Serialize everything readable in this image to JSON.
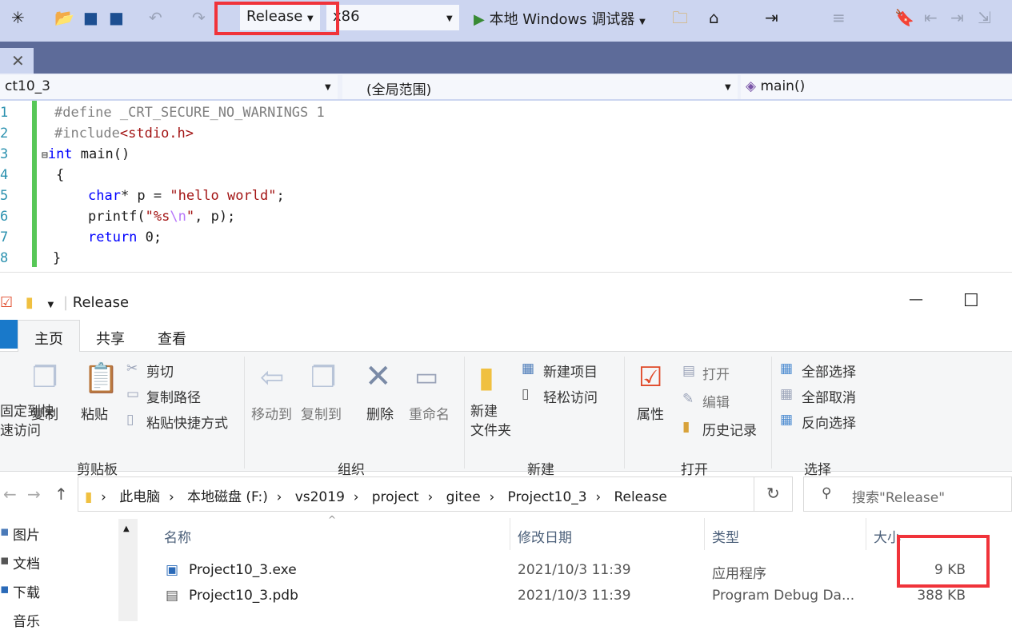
{
  "vs": {
    "config": "Release",
    "platform": "x86",
    "debugger": "本地 Windows 调试器",
    "nav": {
      "project": "ct10_3",
      "scope": "(全局范围)",
      "member": "main()"
    },
    "code": {
      "line_numbers": [
        "1",
        "2",
        "3",
        "4",
        "5",
        "6",
        "7",
        "8"
      ]
    }
  },
  "explorer": {
    "title": "Release",
    "window_controls": {
      "minimize": "—",
      "maximize": "☐"
    },
    "ribbon_tabs": [
      "主页",
      "共享",
      "查看"
    ],
    "clipboard": {
      "pin": "固定到快\n速访问",
      "copy": "复制",
      "paste": "粘贴",
      "cut": "剪切",
      "copy_path": "复制路径",
      "paste_shortcut": "粘贴快捷方式",
      "group": "剪贴板"
    },
    "organize": {
      "move_to": "移动到",
      "copy_to": "复制到",
      "delete": "删除",
      "rename": "重命名",
      "group": "组织"
    },
    "new": {
      "new_folder": "新建\n文件夹",
      "new_item": "新建项目",
      "easy_access": "轻松访问",
      "group": "新建"
    },
    "open": {
      "properties": "属性",
      "open": "打开",
      "edit": "编辑",
      "history": "历史记录",
      "group": "打开"
    },
    "select": {
      "select_all": "全部选择",
      "select_none": "全部取消",
      "invert": "反向选择",
      "group": "选择"
    },
    "breadcrumb": [
      "此电脑",
      "本地磁盘 (F:)",
      "vs2019",
      "project",
      "gitee",
      "Project10_3",
      "Release"
    ],
    "search_placeholder": "搜索\"Release\"",
    "sidebar": [
      "图片",
      "文档",
      "下载",
      "音乐"
    ],
    "columns": [
      "名称",
      "修改日期",
      "类型",
      "大小"
    ],
    "files": [
      {
        "name": "Project10_3.exe",
        "date": "2021/10/3 11:39",
        "type": "应用程序",
        "size": "9 KB"
      },
      {
        "name": "Project10_3.pdb",
        "date": "2021/10/3 11:39",
        "type": "Program Debug Da...",
        "size": "388 KB"
      }
    ]
  }
}
